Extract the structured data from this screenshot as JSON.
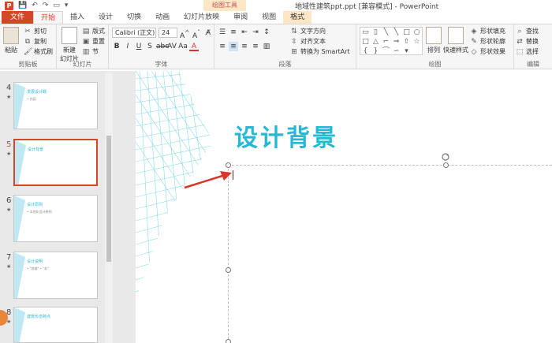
{
  "window": {
    "title": "地域性建筑ppt.ppt [兼容模式] - PowerPoint",
    "context_header": "绘图工具"
  },
  "tabs": [
    {
      "label": "文件"
    },
    {
      "label": "开始"
    },
    {
      "label": "插入"
    },
    {
      "label": "设计"
    },
    {
      "label": "切换"
    },
    {
      "label": "动画"
    },
    {
      "label": "幻灯片放映"
    },
    {
      "label": "审阅"
    },
    {
      "label": "视图"
    },
    {
      "label": "格式"
    }
  ],
  "ribbon": {
    "clipboard": {
      "paste": "粘贴",
      "cut": "剪切",
      "copy": "复制",
      "format_painter": "格式刷",
      "label": "剪贴板"
    },
    "slides": {
      "new_slide": "新建",
      "new_slide_2": "幻灯片",
      "layout": "版式",
      "reset": "重置",
      "section": "节",
      "label": "幻灯片"
    },
    "font": {
      "name": "Calibri (正文)",
      "size": "24",
      "label": "字体"
    },
    "paragraph": {
      "text_direction": "文字方向",
      "align_text": "对齐文本",
      "convert_smartart": "转换为 SmartArt",
      "label": "段落"
    },
    "drawing": {
      "arrange": "排列",
      "quick_styles": "快速样式",
      "shape_fill": "形状填充",
      "shape_outline": "形状轮廓",
      "shape_effects": "形状效果",
      "label": "绘图"
    },
    "editing": {
      "find": "查找",
      "replace": "替换",
      "select": "选择",
      "label": "编辑"
    }
  },
  "thumbnails": [
    {
      "num": "4",
      "title": "发展设计概",
      "line": "• 内容"
    },
    {
      "num": "5",
      "title": "设计背景",
      "line": ""
    },
    {
      "num": "6",
      "title": "设计原则",
      "line": "• 本地化设计原则"
    },
    {
      "num": "7",
      "title": "设计说明",
      "line": "• \"地域\" • \"本\""
    },
    {
      "num": "8",
      "title": "建筑形态特点",
      "line": ""
    }
  ],
  "slide": {
    "title": "设计背景"
  },
  "colors": {
    "accent": "#d24726",
    "title": "#26b8d4",
    "arrow": "#d9352a"
  }
}
